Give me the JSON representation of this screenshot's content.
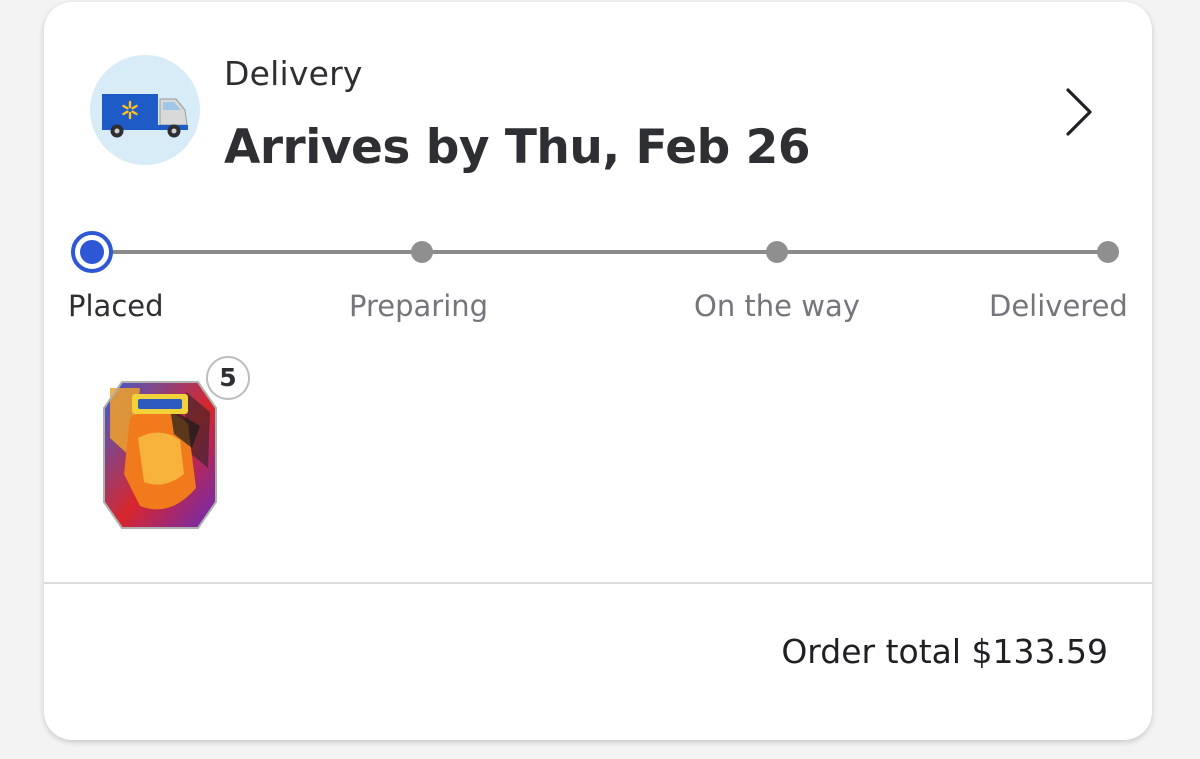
{
  "delivery": {
    "type_label": "Delivery",
    "arrival_text": "Arrives by Thu, Feb 26",
    "icon": "walmart-delivery-truck-icon",
    "details_icon": "chevron-right-icon"
  },
  "progress": {
    "current_stage_index": 0,
    "stages": [
      {
        "label": "Placed"
      },
      {
        "label": "Preparing"
      },
      {
        "label": "On the way"
      },
      {
        "label": "Delivered"
      }
    ]
  },
  "items": [
    {
      "image": "pokemon-charizard-tin",
      "quantity": "5"
    }
  ],
  "order": {
    "total_text": "Order total $133.59"
  },
  "colors": {
    "accent": "#2e57d6",
    "track": "#8a8a8a",
    "node": "#8f8f8f",
    "icon_bg": "#d7ecf7",
    "truck_blue": "#1e5bc6",
    "spark_yellow": "#ffc220"
  }
}
